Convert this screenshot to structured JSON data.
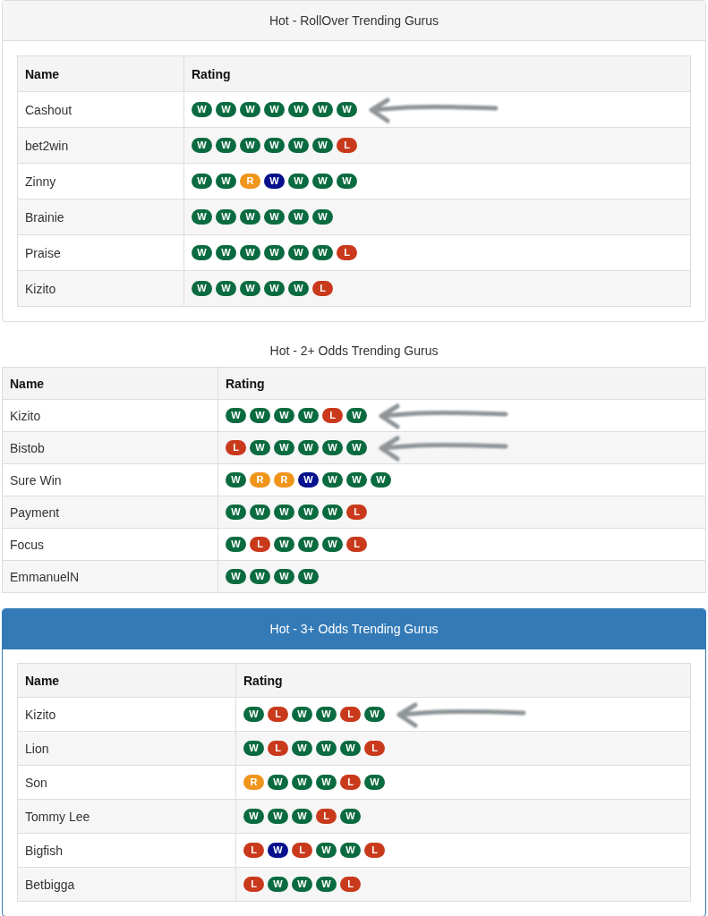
{
  "sections": [
    {
      "kind": "default",
      "title": "Hot - RollOver Trending Gurus",
      "columns": [
        "Name",
        "Rating"
      ],
      "rows": [
        {
          "name": "Cashout",
          "marked": true,
          "rating": [
            {
              "label": "W",
              "color": "#0b6b40"
            },
            {
              "label": "W",
              "color": "#0b6b40"
            },
            {
              "label": "W",
              "color": "#0b6b40"
            },
            {
              "label": "W",
              "color": "#0b6b40"
            },
            {
              "label": "W",
              "color": "#0b6b40"
            },
            {
              "label": "W",
              "color": "#0b6b40"
            },
            {
              "label": "W",
              "color": "#0b6b40"
            }
          ]
        },
        {
          "name": "bet2win",
          "marked": false,
          "rating": [
            {
              "label": "W",
              "color": "#0b6b40"
            },
            {
              "label": "W",
              "color": "#0b6b40"
            },
            {
              "label": "W",
              "color": "#0b6b40"
            },
            {
              "label": "W",
              "color": "#0b6b40"
            },
            {
              "label": "W",
              "color": "#0b6b40"
            },
            {
              "label": "W",
              "color": "#0b6b40"
            },
            {
              "label": "L",
              "color": "#c9391b"
            }
          ]
        },
        {
          "name": "Zinny",
          "marked": false,
          "rating": [
            {
              "label": "W",
              "color": "#0b6b40"
            },
            {
              "label": "W",
              "color": "#0b6b40"
            },
            {
              "label": "R",
              "color": "#f0951b"
            },
            {
              "label": "W",
              "color": "#05108c"
            },
            {
              "label": "W",
              "color": "#0b6b40"
            },
            {
              "label": "W",
              "color": "#0b6b40"
            },
            {
              "label": "W",
              "color": "#0b6b40"
            }
          ]
        },
        {
          "name": "Brainie",
          "marked": false,
          "rating": [
            {
              "label": "W",
              "color": "#0b6b40"
            },
            {
              "label": "W",
              "color": "#0b6b40"
            },
            {
              "label": "W",
              "color": "#0b6b40"
            },
            {
              "label": "W",
              "color": "#0b6b40"
            },
            {
              "label": "W",
              "color": "#0b6b40"
            },
            {
              "label": "W",
              "color": "#0b6b40"
            }
          ]
        },
        {
          "name": "Praise",
          "marked": false,
          "rating": [
            {
              "label": "W",
              "color": "#0b6b40"
            },
            {
              "label": "W",
              "color": "#0b6b40"
            },
            {
              "label": "W",
              "color": "#0b6b40"
            },
            {
              "label": "W",
              "color": "#0b6b40"
            },
            {
              "label": "W",
              "color": "#0b6b40"
            },
            {
              "label": "W",
              "color": "#0b6b40"
            },
            {
              "label": "L",
              "color": "#c9391b"
            }
          ]
        },
        {
          "name": "Kizito",
          "marked": false,
          "rating": [
            {
              "label": "W",
              "color": "#0b6b40"
            },
            {
              "label": "W",
              "color": "#0b6b40"
            },
            {
              "label": "W",
              "color": "#0b6b40"
            },
            {
              "label": "W",
              "color": "#0b6b40"
            },
            {
              "label": "W",
              "color": "#0b6b40"
            },
            {
              "label": "L",
              "color": "#c9391b"
            }
          ]
        }
      ]
    },
    {
      "kind": "plain",
      "title": "Hot - 2+ Odds Trending Gurus",
      "columns": [
        "Name",
        "Rating"
      ],
      "rows": [
        {
          "name": "Kizito",
          "marked": true,
          "rating": [
            {
              "label": "W",
              "color": "#0b6b40"
            },
            {
              "label": "W",
              "color": "#0b6b40"
            },
            {
              "label": "W",
              "color": "#0b6b40"
            },
            {
              "label": "W",
              "color": "#0b6b40"
            },
            {
              "label": "L",
              "color": "#c9391b"
            },
            {
              "label": "W",
              "color": "#0b6b40"
            }
          ]
        },
        {
          "name": "Bistob",
          "marked": true,
          "rating": [
            {
              "label": "L",
              "color": "#c9391b"
            },
            {
              "label": "W",
              "color": "#0b6b40"
            },
            {
              "label": "W",
              "color": "#0b6b40"
            },
            {
              "label": "W",
              "color": "#0b6b40"
            },
            {
              "label": "W",
              "color": "#0b6b40"
            },
            {
              "label": "W",
              "color": "#0b6b40"
            }
          ]
        },
        {
          "name": "Sure Win",
          "marked": false,
          "rating": [
            {
              "label": "W",
              "color": "#0b6b40"
            },
            {
              "label": "R",
              "color": "#f0951b"
            },
            {
              "label": "R",
              "color": "#f0951b"
            },
            {
              "label": "W",
              "color": "#05108c"
            },
            {
              "label": "W",
              "color": "#0b6b40"
            },
            {
              "label": "W",
              "color": "#0b6b40"
            },
            {
              "label": "W",
              "color": "#0b6b40"
            }
          ]
        },
        {
          "name": "Payment",
          "marked": false,
          "rating": [
            {
              "label": "W",
              "color": "#0b6b40"
            },
            {
              "label": "W",
              "color": "#0b6b40"
            },
            {
              "label": "W",
              "color": "#0b6b40"
            },
            {
              "label": "W",
              "color": "#0b6b40"
            },
            {
              "label": "W",
              "color": "#0b6b40"
            },
            {
              "label": "L",
              "color": "#c9391b"
            }
          ]
        },
        {
          "name": "Focus",
          "marked": false,
          "rating": [
            {
              "label": "W",
              "color": "#0b6b40"
            },
            {
              "label": "L",
              "color": "#c9391b"
            },
            {
              "label": "W",
              "color": "#0b6b40"
            },
            {
              "label": "W",
              "color": "#0b6b40"
            },
            {
              "label": "W",
              "color": "#0b6b40"
            },
            {
              "label": "L",
              "color": "#c9391b"
            }
          ]
        },
        {
          "name": "EmmanuelN",
          "marked": false,
          "rating": [
            {
              "label": "W",
              "color": "#0b6b40"
            },
            {
              "label": "W",
              "color": "#0b6b40"
            },
            {
              "label": "W",
              "color": "#0b6b40"
            },
            {
              "label": "W",
              "color": "#0b6b40"
            }
          ]
        }
      ]
    },
    {
      "kind": "primary",
      "title": "Hot - 3+ Odds Trending Gurus",
      "columns": [
        "Name",
        "Rating"
      ],
      "rows": [
        {
          "name": "Kizito",
          "marked": true,
          "rating": [
            {
              "label": "W",
              "color": "#0b6b40"
            },
            {
              "label": "L",
              "color": "#c9391b"
            },
            {
              "label": "W",
              "color": "#0b6b40"
            },
            {
              "label": "W",
              "color": "#0b6b40"
            },
            {
              "label": "L",
              "color": "#c9391b"
            },
            {
              "label": "W",
              "color": "#0b6b40"
            }
          ]
        },
        {
          "name": "Lion",
          "marked": false,
          "rating": [
            {
              "label": "W",
              "color": "#0b6b40"
            },
            {
              "label": "L",
              "color": "#c9391b"
            },
            {
              "label": "W",
              "color": "#0b6b40"
            },
            {
              "label": "W",
              "color": "#0b6b40"
            },
            {
              "label": "W",
              "color": "#0b6b40"
            },
            {
              "label": "L",
              "color": "#c9391b"
            }
          ]
        },
        {
          "name": "Son",
          "marked": false,
          "rating": [
            {
              "label": "R",
              "color": "#f0951b"
            },
            {
              "label": "W",
              "color": "#0b6b40"
            },
            {
              "label": "W",
              "color": "#0b6b40"
            },
            {
              "label": "W",
              "color": "#0b6b40"
            },
            {
              "label": "L",
              "color": "#c9391b"
            },
            {
              "label": "W",
              "color": "#0b6b40"
            }
          ]
        },
        {
          "name": "Tommy Lee",
          "marked": false,
          "rating": [
            {
              "label": "W",
              "color": "#0b6b40"
            },
            {
              "label": "W",
              "color": "#0b6b40"
            },
            {
              "label": "W",
              "color": "#0b6b40"
            },
            {
              "label": "L",
              "color": "#c9391b"
            },
            {
              "label": "W",
              "color": "#0b6b40"
            }
          ]
        },
        {
          "name": "Bigfish",
          "marked": false,
          "rating": [
            {
              "label": "L",
              "color": "#c9391b"
            },
            {
              "label": "W",
              "color": "#05108c"
            },
            {
              "label": "L",
              "color": "#c9391b"
            },
            {
              "label": "W",
              "color": "#0b6b40"
            },
            {
              "label": "W",
              "color": "#0b6b40"
            },
            {
              "label": "L",
              "color": "#c9391b"
            }
          ]
        },
        {
          "name": "Betbigga",
          "marked": false,
          "rating": [
            {
              "label": "L",
              "color": "#c9391b"
            },
            {
              "label": "W",
              "color": "#0b6b40"
            },
            {
              "label": "W",
              "color": "#0b6b40"
            },
            {
              "label": "W",
              "color": "#0b6b40"
            },
            {
              "label": "L",
              "color": "#c9391b"
            }
          ]
        }
      ]
    }
  ]
}
